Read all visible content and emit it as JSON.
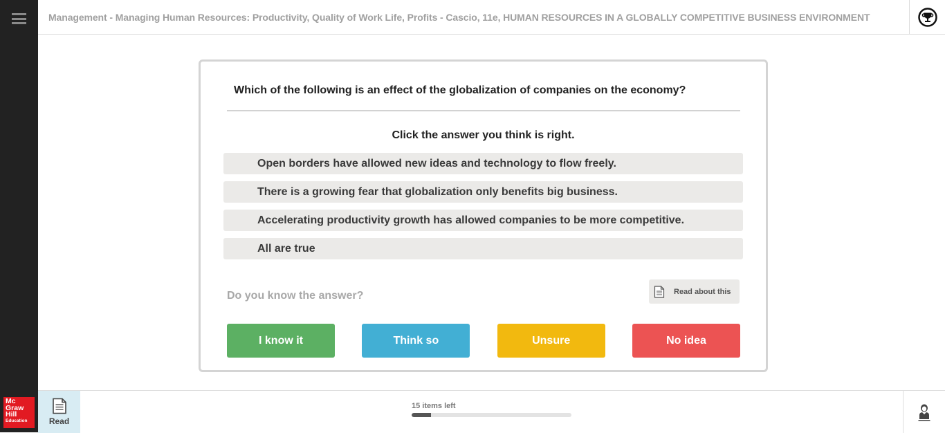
{
  "header": {
    "title": "Management - Managing Human Resources: Productivity, Quality of Work Life, Profits - Cascio, 11e, HUMAN RESOURCES IN A GLOBALLY COMPETITIVE BUSINESS ENVIRONMENT",
    "menu_icon": "hamburger-menu-icon",
    "trophy_icon": "trophy-icon"
  },
  "question": {
    "text": "Which of the following is an effect of the globalization of companies on the economy?",
    "instruction": "Click the answer you think is right.",
    "options": [
      {
        "label": "Open borders have allowed new ideas and technology to flow freely."
      },
      {
        "label": "There is a growing fear that globalization only benefits big business."
      },
      {
        "label": "Accelerating productivity growth has allowed companies to be more competitive."
      },
      {
        "label": "All are true"
      }
    ],
    "know_label": "Do you know the answer?",
    "read_about": {
      "label": "Read about this",
      "icon": "document-icon"
    }
  },
  "confidence_buttons": [
    {
      "label": "I know it",
      "color": "#5cb063"
    },
    {
      "label": "Think so",
      "color": "#42afd4"
    },
    {
      "label": "Unsure",
      "color": "#f2b90f"
    },
    {
      "label": "No idea",
      "color": "#ec5353"
    }
  ],
  "footer": {
    "brand": {
      "line1": "Mc",
      "line2": "Graw",
      "line3": "Hill",
      "line4": "Education"
    },
    "read_tab": {
      "label": "Read",
      "icon": "document-icon"
    },
    "progress": {
      "text": "15 items left",
      "fraction": 0.12
    },
    "account_icon": "person-icon"
  }
}
